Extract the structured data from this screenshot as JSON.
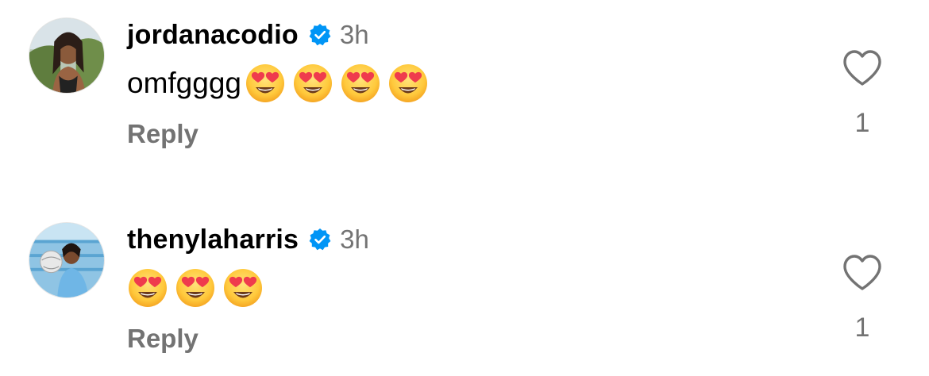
{
  "comments": [
    {
      "username": "jordanacodio",
      "verified": true,
      "time": "3h",
      "text": "omfgggg",
      "emojis": [
        "heart-eyes-emoji",
        "heart-eyes-emoji",
        "heart-eyes-emoji",
        "heart-eyes-emoji"
      ],
      "reply_label": "Reply",
      "like_icon": "heart-outline-icon",
      "like_count": "1"
    },
    {
      "username": "thenylaharris",
      "verified": true,
      "time": "3h",
      "text": "",
      "emojis": [
        "heart-eyes-emoji",
        "heart-eyes-emoji",
        "heart-eyes-emoji"
      ],
      "reply_label": "Reply",
      "like_icon": "heart-outline-icon",
      "like_count": "1"
    }
  ],
  "colors": {
    "verified_blue": "#0095f6",
    "secondary_text": "#737373",
    "emoji_face": "#ffc93c",
    "emoji_heart": "#ef3b4d"
  }
}
